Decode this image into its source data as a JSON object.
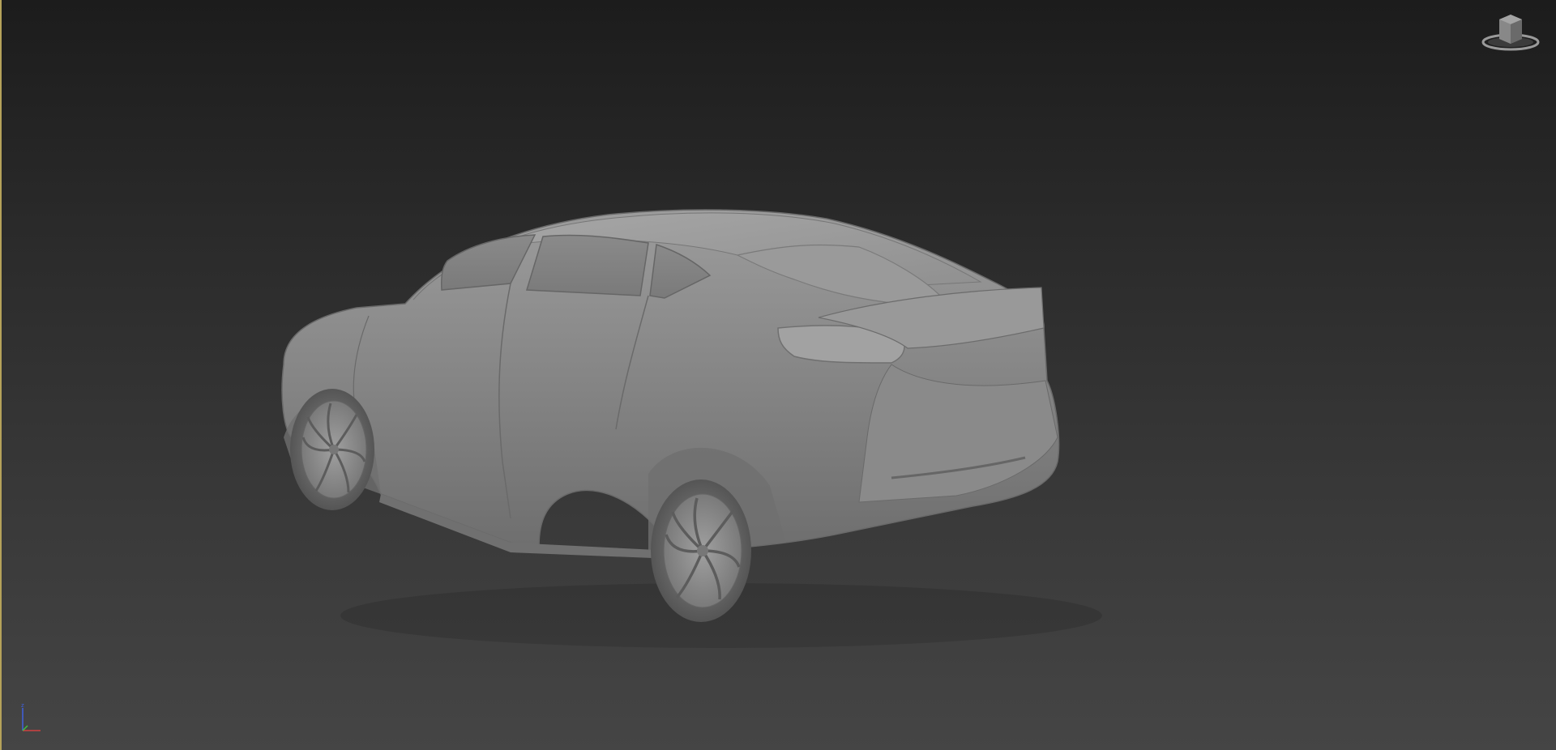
{
  "viewport": {
    "background_top": "#1c1c1c",
    "background_bottom": "#454545",
    "active_border_color": "#b5a25a"
  },
  "viewcube": {
    "icon": "viewcube-icon"
  },
  "axis_tripod": {
    "icon": "axis-tripod-icon",
    "x_color": "#d04040",
    "y_color": "#40c040",
    "z_color": "#4060e0"
  },
  "model": {
    "icon": "car-model",
    "shading": "grey-clay",
    "base_color": "#8a8a8a"
  }
}
